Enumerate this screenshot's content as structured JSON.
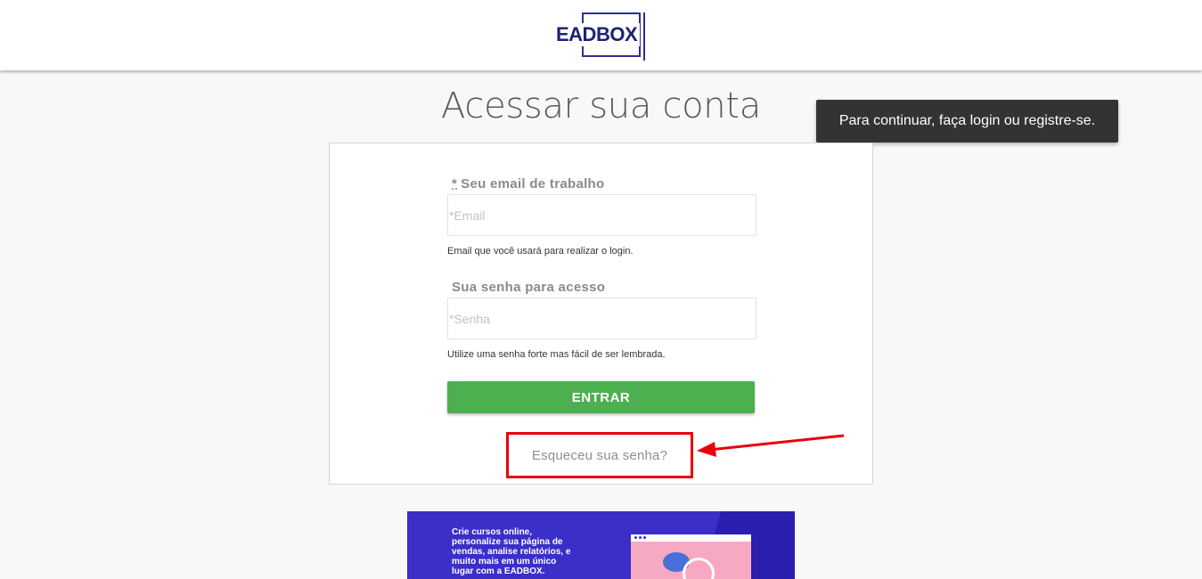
{
  "header": {
    "logo_text": "EADBOX"
  },
  "page": {
    "title": "Acessar sua conta"
  },
  "toast": {
    "message": "Para continuar, faça login ou registre-se."
  },
  "form": {
    "email": {
      "required_mark": "*",
      "label": "Seu email de trabalho",
      "placeholder": "*Email",
      "value": "",
      "help": "Email que você usará para realizar o login."
    },
    "password": {
      "label": "Sua senha para acesso",
      "placeholder": "*Senha",
      "value": "",
      "help": "Utilize uma senha forte mas fácil de ser lembrada."
    },
    "submit_label": "ENTRAR",
    "forgot_label": "Esqueceu sua senha?"
  },
  "banner": {
    "lines": [
      "Crie cursos online,",
      "personalize sua página de",
      "vendas, analise relatórios, e",
      "muito mais em um único",
      "lugar com a EADBOX."
    ]
  },
  "colors": {
    "brand": "#1e2270",
    "primary_button": "#4caf50",
    "annotation": "#e8000b",
    "toast_bg": "#333333",
    "banner_bg": "#3a2fc8"
  }
}
